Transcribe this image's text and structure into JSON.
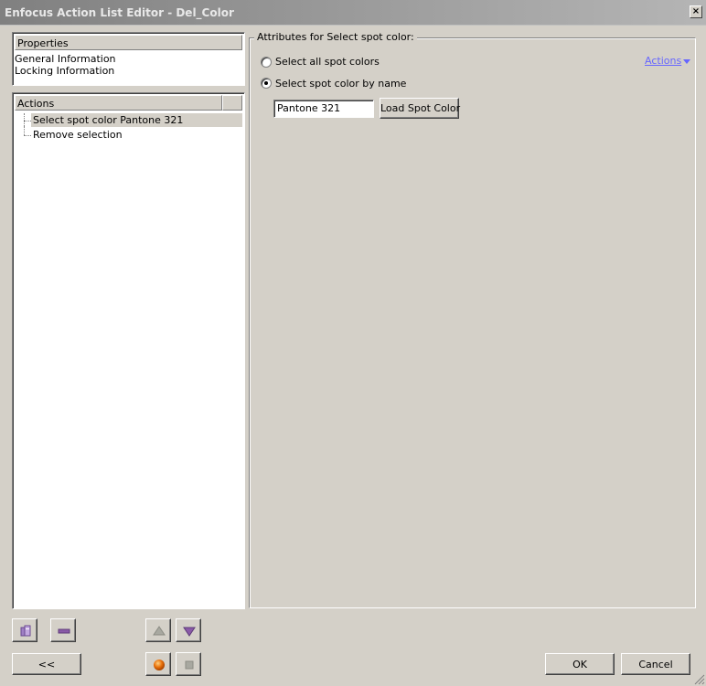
{
  "window": {
    "title": "Enfocus Action List Editor - Del_Color",
    "close_label": "×"
  },
  "properties": {
    "header": "Properties",
    "items": [
      "General Information",
      "Locking Information"
    ]
  },
  "actions_panel": {
    "header": "Actions",
    "items": [
      {
        "label": "Select spot color Pantone 321",
        "selected": true
      },
      {
        "label": "Remove selection",
        "selected": false
      }
    ]
  },
  "attributes": {
    "group_title": "Attributes for Select spot color:",
    "actions_link": "Actions",
    "options": [
      {
        "label": "Select all spot colors",
        "checked": false
      },
      {
        "label": "Select spot color by name",
        "checked": true
      }
    ],
    "color_name_value": "Pantone 321",
    "load_button": "Load Spot Color"
  },
  "footer": {
    "back_label": "<<",
    "ok_label": "OK",
    "cancel_label": "Cancel"
  },
  "icons": {
    "add": "add-action-icon",
    "remove": "remove-action-icon",
    "move_up": "move-up-icon",
    "move_down": "move-down-icon",
    "record": "record-icon",
    "stop": "stop-icon"
  },
  "colors": {
    "link": "#6666ff",
    "accent_purple": "#8a5aa8",
    "record_orange": "#e8700a"
  }
}
